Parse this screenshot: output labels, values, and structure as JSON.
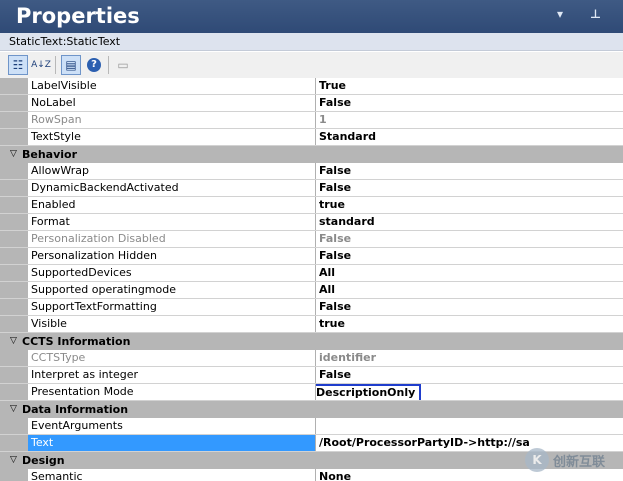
{
  "window": {
    "title": "Properties",
    "object_name": "StaticText:StaticText",
    "toolbar_buttons": [
      {
        "name": "categorized-icon",
        "glyph": "☷"
      },
      {
        "name": "alphabetical-icon",
        "glyph": "A↓Z"
      },
      {
        "name": "properties-icon",
        "glyph": "▤"
      },
      {
        "name": "help-icon",
        "glyph": "?"
      },
      {
        "name": "property-pages-icon",
        "glyph": "▭"
      }
    ],
    "title_icons": [
      "▾",
      "⊥"
    ]
  },
  "grid": {
    "top_props": [
      {
        "name": "LabelVisible",
        "value": "True",
        "disabled": false
      },
      {
        "name": "NoLabel",
        "value": "False",
        "disabled": false
      },
      {
        "name": "RowSpan",
        "value": "1",
        "disabled": true
      },
      {
        "name": "TextStyle",
        "value": "Standard",
        "disabled": false
      }
    ],
    "behavior": {
      "label": "Behavior",
      "props": [
        {
          "name": "AllowWrap",
          "value": "False",
          "disabled": false
        },
        {
          "name": "DynamicBackendActivated",
          "value": "False",
          "disabled": false
        },
        {
          "name": "Enabled",
          "value": "true",
          "disabled": false
        },
        {
          "name": "Format",
          "value": "standard",
          "disabled": false
        },
        {
          "name": "Personalization Disabled",
          "value": "False",
          "disabled": true
        },
        {
          "name": "Personalization Hidden",
          "value": "False",
          "disabled": false
        },
        {
          "name": "SupportedDevices",
          "value": "All",
          "disabled": false
        },
        {
          "name": "Supported operatingmode",
          "value": "All",
          "disabled": false
        },
        {
          "name": "SupportTextFormatting",
          "value": "False",
          "disabled": false
        },
        {
          "name": "Visible",
          "value": "true",
          "disabled": false
        }
      ]
    },
    "ccts": {
      "label": "CCTS Information",
      "props": [
        {
          "name": "CCTSType",
          "value": "identifier",
          "disabled": true
        },
        {
          "name": "Interpret as integer",
          "value": "False",
          "disabled": false
        },
        {
          "name": "Presentation Mode",
          "value": "DescriptionOnly",
          "disabled": false,
          "highlighted": true
        }
      ]
    },
    "data_info": {
      "label": "Data Information",
      "props": [
        {
          "name": "EventArguments",
          "value": "",
          "disabled": false
        },
        {
          "name": "Text",
          "value": "/Root/ProcessorPartyID->http://sa",
          "disabled": false,
          "selected": true
        }
      ]
    },
    "design": {
      "label": "Design",
      "props": [
        {
          "name": "Semantic",
          "value": "None",
          "disabled": false
        }
      ]
    }
  },
  "watermark": {
    "logo": "K",
    "text": "创新互联"
  }
}
